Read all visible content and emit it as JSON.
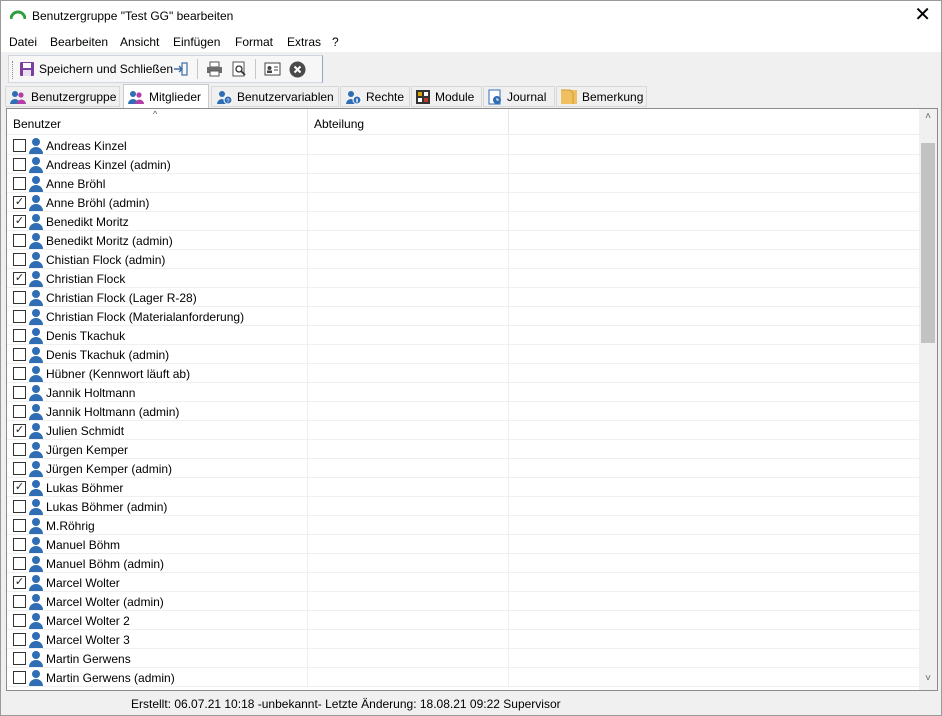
{
  "window": {
    "title": "Benutzergruppe \"Test GG\" bearbeiten",
    "close_glyph": "✕"
  },
  "menu": [
    "Datei",
    "Bearbeiten",
    "Ansicht",
    "Einfügen",
    "Format",
    "Extras",
    "?"
  ],
  "toolbar": {
    "save_close_label": "Speichern und Schließen",
    "icons": [
      "save-icon",
      "exit-icon",
      "print-icon",
      "print-preview-icon",
      "properties-icon",
      "cancel-icon"
    ]
  },
  "tabs": [
    {
      "label": "Benutzergruppe",
      "icon": "group-icon",
      "active": false
    },
    {
      "label": "Mitglieder",
      "icon": "members-icon",
      "active": true
    },
    {
      "label": "Benutzervariablen",
      "icon": "user-variables-icon",
      "active": false
    },
    {
      "label": "Rechte",
      "icon": "rights-icon",
      "active": false
    },
    {
      "label": "Module",
      "icon": "modules-icon",
      "active": false
    },
    {
      "label": "Journal",
      "icon": "journal-icon",
      "active": false
    },
    {
      "label": "Bemerkung",
      "icon": "note-icon",
      "active": false
    }
  ],
  "list": {
    "columns": [
      "Benutzer",
      "Abteilung"
    ],
    "sort_glyph": "^",
    "check_glyph": "✓",
    "rows": [
      {
        "name": "Andreas Kinzel",
        "checked": false
      },
      {
        "name": "Andreas Kinzel (admin)",
        "checked": false
      },
      {
        "name": "Anne Bröhl",
        "checked": false
      },
      {
        "name": "Anne Bröhl (admin)",
        "checked": true
      },
      {
        "name": "Benedikt Moritz",
        "checked": true
      },
      {
        "name": "Benedikt Moritz (admin)",
        "checked": false
      },
      {
        "name": "Chistian Flock (admin)",
        "checked": false
      },
      {
        "name": "Christian Flock",
        "checked": true
      },
      {
        "name": "Christian Flock (Lager R-28)",
        "checked": false
      },
      {
        "name": "Christian Flock (Materialanforderung)",
        "checked": false
      },
      {
        "name": "Denis Tkachuk",
        "checked": false
      },
      {
        "name": "Denis Tkachuk (admin)",
        "checked": false
      },
      {
        "name": "Hübner (Kennwort läuft ab)",
        "checked": false
      },
      {
        "name": "Jannik Holtmann",
        "checked": false
      },
      {
        "name": "Jannik Holtmann (admin)",
        "checked": false
      },
      {
        "name": "Julien Schmidt",
        "checked": true
      },
      {
        "name": "Jürgen Kemper",
        "checked": false
      },
      {
        "name": "Jürgen Kemper (admin)",
        "checked": false
      },
      {
        "name": "Lukas Böhmer",
        "checked": true
      },
      {
        "name": "Lukas Böhmer (admin)",
        "checked": false
      },
      {
        "name": "M.Röhrig",
        "checked": false
      },
      {
        "name": "Manuel Böhm",
        "checked": false
      },
      {
        "name": "Manuel Böhm (admin)",
        "checked": false
      },
      {
        "name": "Marcel Wolter",
        "checked": true
      },
      {
        "name": "Marcel Wolter (admin)",
        "checked": false
      },
      {
        "name": "Marcel Wolter 2",
        "checked": false
      },
      {
        "name": "Marcel Wolter 3",
        "checked": false
      },
      {
        "name": "Martin Gerwens",
        "checked": false
      },
      {
        "name": "Martin Gerwens (admin)",
        "checked": false
      }
    ]
  },
  "scrollbar": {
    "up_glyph": "˄",
    "down_glyph": "˅"
  },
  "status": "Erstellt: 06.07.21 10:18 -unbekannt-  Letzte Änderung: 18.08.21 09:22 Supervisor",
  "colors": {
    "icon_blue": "#2f6db5",
    "accent_green": "#2e9e3e"
  }
}
